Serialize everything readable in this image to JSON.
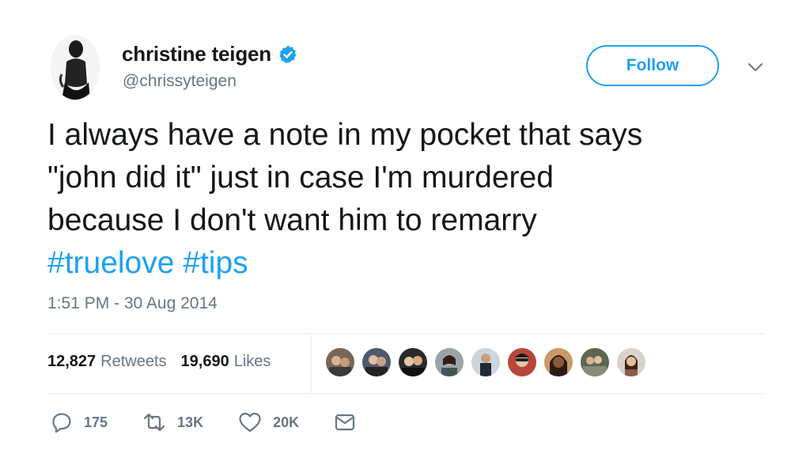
{
  "header": {
    "name": "christine teigen",
    "handle": "@chrissyteigen",
    "follow_label": "Follow",
    "verified_icon": "verified-badge-icon",
    "colors": {
      "accent": "#1da1f2",
      "secondary_text": "#657786",
      "primary_text": "#14171a"
    }
  },
  "tweet": {
    "lines": [
      "I always have a note in my pocket that says",
      "\"john did it\" just in case I'm murdered",
      "because I don't want him to remarry"
    ],
    "hashtags": [
      "#truelove",
      "#tips"
    ],
    "timestamp": "1:51 PM - 30 Aug 2014"
  },
  "stats": {
    "retweets_count": "12,827",
    "retweets_label": "Retweets",
    "likes_count": "19,690",
    "likes_label": "Likes",
    "liker_avatar_count": 9
  },
  "actions": [
    {
      "icon": "reply-icon",
      "count": "175"
    },
    {
      "icon": "retweet-icon",
      "count": "13K"
    },
    {
      "icon": "like-heart-icon",
      "count": "20K"
    },
    {
      "icon": "direct-message-icon",
      "count": ""
    }
  ]
}
